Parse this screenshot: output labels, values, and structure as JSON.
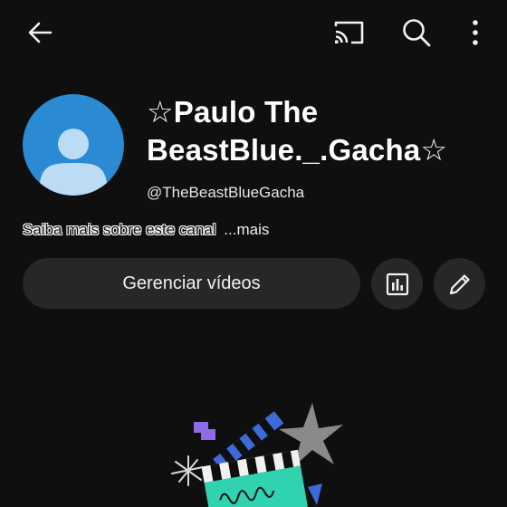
{
  "topbar": {
    "icons": [
      "arrow-left-icon",
      "cast-icon",
      "search-icon",
      "more-vertical-icon"
    ]
  },
  "channel": {
    "name_line1": "☆Paulo The",
    "name_line2": "BeastBlue._.Gacha☆",
    "handle": "@TheBeastBlueGacha",
    "about_text": "Saiba mais sobre este canal",
    "about_more": "...mais"
  },
  "actions": {
    "manage_label": "Gerenciar vídeos",
    "icons": [
      "analytics-icon",
      "pencil-icon"
    ]
  },
  "colors": {
    "background": "#0f0f0f",
    "button": "#272727",
    "avatar": "#2a8ad3",
    "avatar_figure": "#bcdcf5"
  }
}
